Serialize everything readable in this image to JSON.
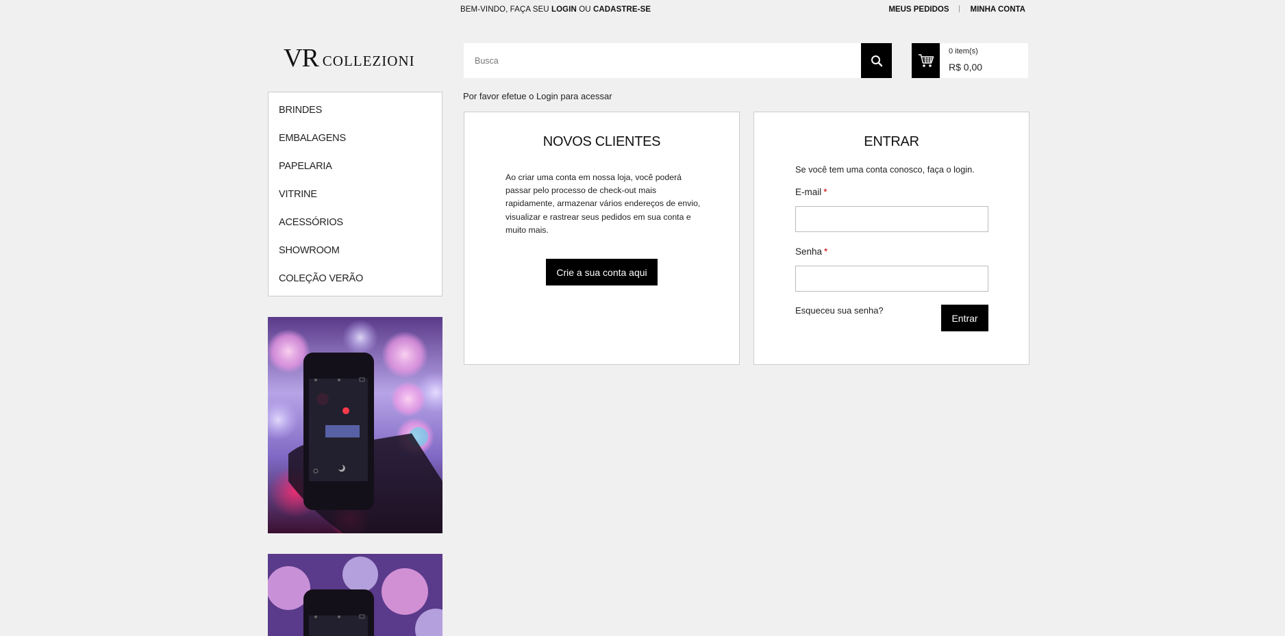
{
  "topbar": {
    "welcome_prefix": "BEM-VINDO, FAÇA SEU",
    "login": "LOGIN",
    "or": "OU",
    "signup": "CADASTRE-SE",
    "my_orders": "MEUS PEDIDOS",
    "my_account": "MINHA CONTA"
  },
  "logo": {
    "vr": "VR",
    "name": "COLLEZIONI"
  },
  "search": {
    "placeholder": "Busca",
    "value": ""
  },
  "cart": {
    "items": "0 item(s)",
    "total": "R$ 0,00"
  },
  "nav": {
    "items": [
      {
        "label": "BRINDES"
      },
      {
        "label": "EMBALAGENS"
      },
      {
        "label": "PAPELARIA"
      },
      {
        "label": "VITRINE"
      },
      {
        "label": "ACESSÓRIOS"
      },
      {
        "label": "SHOWROOM"
      },
      {
        "label": "COLEÇÃO VERÃO"
      }
    ]
  },
  "main": {
    "notice": "Por favor efetue o Login para acessar",
    "new_customers": {
      "title": "NOVOS CLIENTES",
      "text": "Ao criar uma conta em nossa loja, você poderá passar pelo processo de check-out mais rapidamente, armazenar vários endereços de envio, visualizar e rastrear seus pedidos em sua conta e muito mais.",
      "button": "Crie a sua conta aqui"
    },
    "login": {
      "title": "ENTRAR",
      "intro": "Se você tem uma conta conosco, faça o login.",
      "email_label": "E-mail",
      "password_label": "Senha",
      "required_mark": "*",
      "forgot": "Esqueceu sua senha?",
      "button": "Entrar"
    }
  },
  "colors": {
    "accent": "#000000",
    "background": "#f0f0f0",
    "required": "#cc0000"
  }
}
